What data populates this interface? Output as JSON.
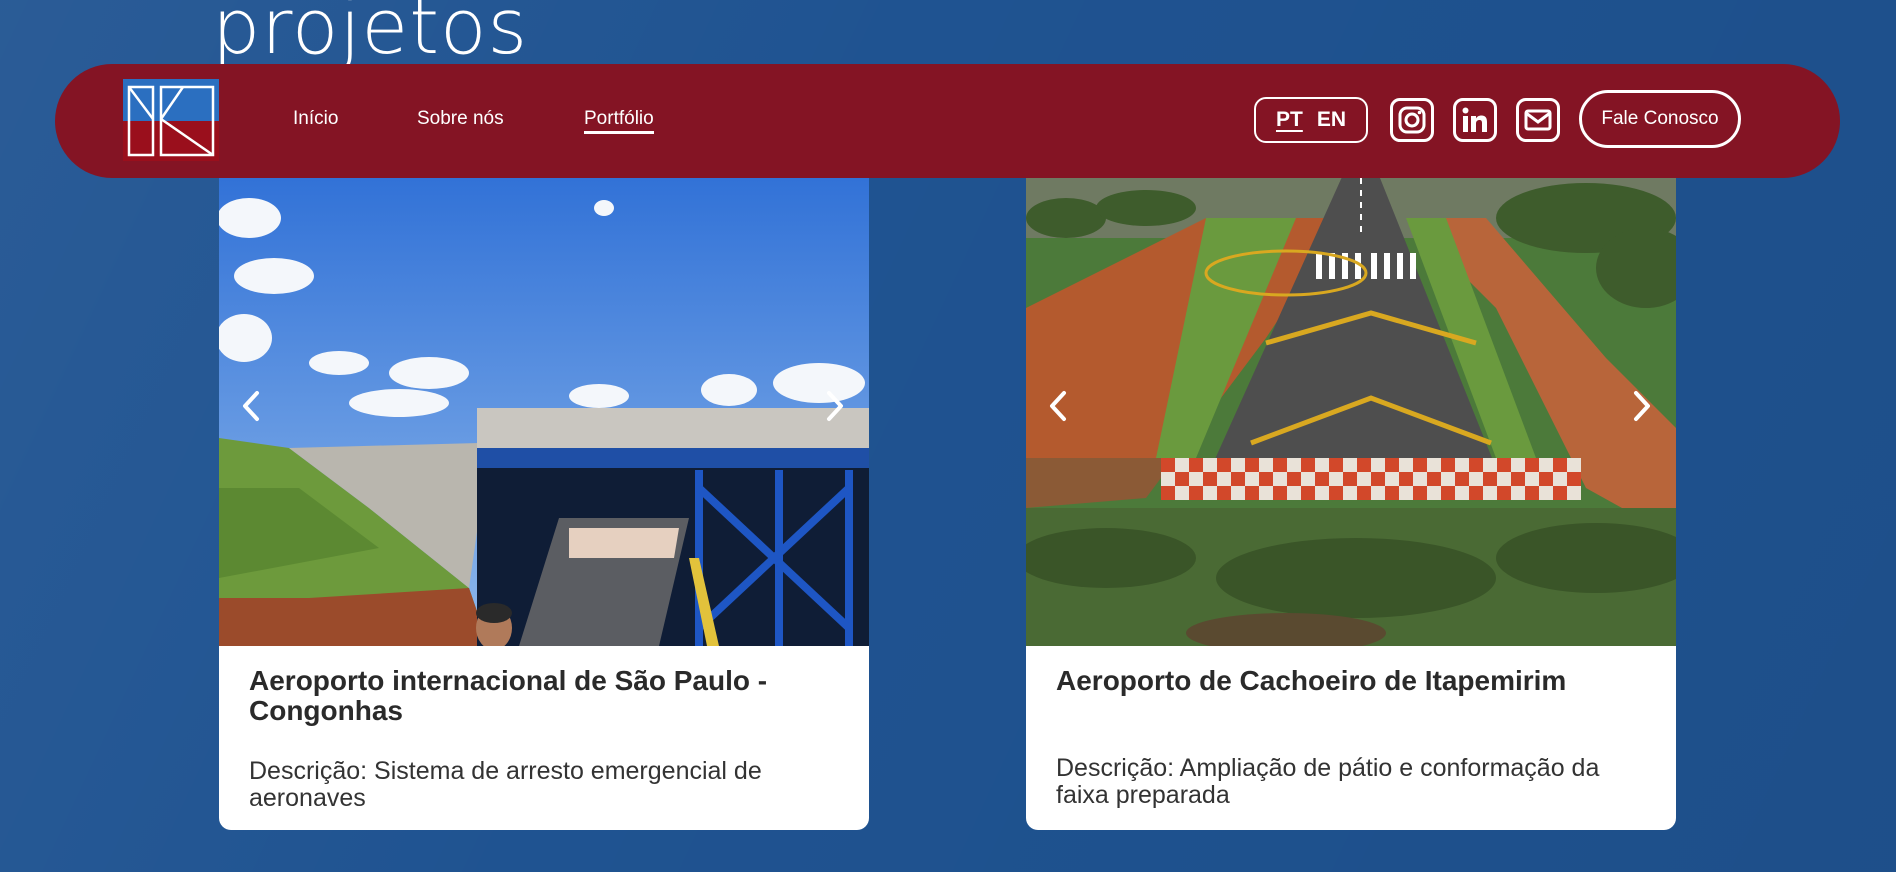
{
  "page": {
    "heading": "projetos"
  },
  "nav": {
    "links": [
      {
        "label": "Início"
      },
      {
        "label": "Sobre nós"
      },
      {
        "label": "Portfólio",
        "active": true
      }
    ],
    "lang": {
      "pt": "PT",
      "en": "EN",
      "active": "PT"
    },
    "social": [
      "instagram-icon",
      "linkedin-icon",
      "mail-icon"
    ],
    "cta_label": "Fale Conosco"
  },
  "projects": [
    {
      "title": "Aeroporto internacional de São Paulo - Congonhas",
      "description": "Descrição: Sistema de arresto emergencial de aeronaves"
    },
    {
      "title": "Aeroporto de Cachoeiro de Itapemirim",
      "description": "Descrição: Ampliação de pátio e conformação da faixa preparada"
    }
  ],
  "colors": {
    "background": "#1f5391",
    "navbar": "#841424",
    "logo_blue": "#2b6fc0",
    "logo_red": "#9a0f1c",
    "card": "#ffffff"
  }
}
